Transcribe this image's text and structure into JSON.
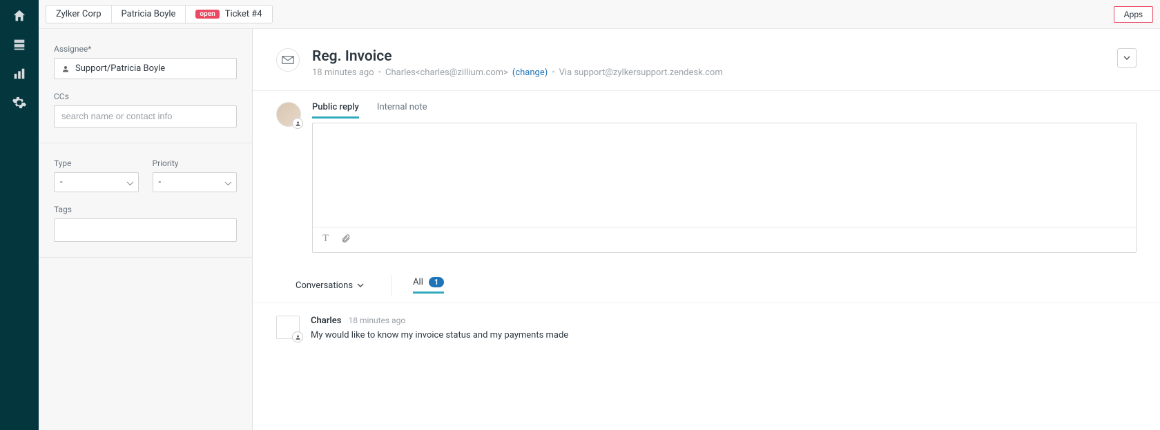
{
  "nav": {
    "items": [
      "home-icon",
      "inbox-icon",
      "reports-icon",
      "settings-icon"
    ]
  },
  "tabs": {
    "org": "Zylker Corp",
    "person": "Patricia Boyle",
    "ticket_badge": "open",
    "ticket_label": "Ticket #4"
  },
  "apps_button": "Apps",
  "sidebar": {
    "assignee_label": "Assignee*",
    "assignee_value": "Support/Patricia Boyle",
    "ccs_label": "CCs",
    "ccs_placeholder": "search name or contact info",
    "type_label": "Type",
    "type_value": "-",
    "priority_label": "Priority",
    "priority_value": "-",
    "tags_label": "Tags"
  },
  "ticket": {
    "title": "Reg. Invoice",
    "time": "18 minutes ago",
    "requester": "Charles<charles@zillium.com>",
    "change": "(change)",
    "via": "Via support@zylkersupport.zendesk.com"
  },
  "reply": {
    "tab_public": "Public reply",
    "tab_internal": "Internal note"
  },
  "conv": {
    "dropdown": "Conversations",
    "all": "All",
    "count": "1"
  },
  "message": {
    "name": "Charles",
    "time": "18 minutes ago",
    "body": "My would like to know my invoice status and my payments made"
  }
}
